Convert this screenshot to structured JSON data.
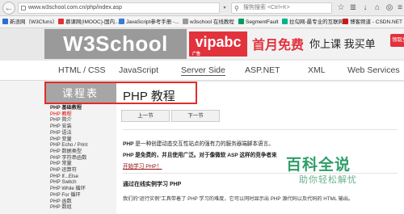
{
  "browser": {
    "url": "www.w3school.com.cn/php/index.asp",
    "search_placeholder": "搜狗搜索 <Ctrl+K>",
    "back_icon": "back-arrow-icon",
    "bookmarks": [
      {
        "label": "新浪网（W3Cfuns）",
        "color": "#2b6fd6"
      },
      {
        "label": "慕课网(IMOOC)-国内...",
        "color": "#d33"
      },
      {
        "label": "JavaScript参考手册 -...",
        "color": "#3a7bd5"
      },
      {
        "label": "w3school 在线教程",
        "color": "#9a9a9a"
      },
      {
        "label": "SegmentFault",
        "color": "#009a61"
      },
      {
        "label": "拉勾网-最专业的互联网...",
        "color": "#00b38a"
      },
      {
        "label": "博客频道 - CSDN.NET",
        "color": "#c91b1b"
      }
    ]
  },
  "header": {
    "logo": "W3School",
    "ad": {
      "brand": "vipabc",
      "brand_sub": "广告",
      "headline": "首月免费",
      "tagline": "你上课 我买单",
      "cta": "领取免费"
    }
  },
  "nav": {
    "items": [
      {
        "label": "HTML / CSS",
        "active": false
      },
      {
        "label": "JavaScript",
        "active": false
      },
      {
        "label": "Server Side",
        "active": true
      },
      {
        "label": "ASP.NET",
        "active": false
      },
      {
        "label": "XML",
        "active": false
      },
      {
        "label": "Web Services",
        "active": false
      }
    ]
  },
  "sidebar": {
    "title": "课程表",
    "items": [
      {
        "label": "PHP 基础教程",
        "type": "head"
      },
      {
        "label": "PHP 教程",
        "type": "current"
      },
      {
        "label": "PHP 简介",
        "type": "item"
      },
      {
        "label": "PHP 安装",
        "type": "item"
      },
      {
        "label": "PHP 语法",
        "type": "item"
      },
      {
        "label": "PHP 变量",
        "type": "item"
      },
      {
        "label": "PHP Echo / Print",
        "type": "item"
      },
      {
        "label": "PHP 数据类型",
        "type": "item"
      },
      {
        "label": "PHP 字符串函数",
        "type": "item"
      },
      {
        "label": "PHP 常量",
        "type": "item"
      },
      {
        "label": "PHP 运算符",
        "type": "item"
      },
      {
        "label": "PHP If...Else",
        "type": "item"
      },
      {
        "label": "PHP Switch",
        "type": "item"
      },
      {
        "label": "PHP While 循环",
        "type": "item"
      },
      {
        "label": "PHP For 循环",
        "type": "item"
      },
      {
        "label": "PHP 函数",
        "type": "item"
      },
      {
        "label": "PHP 数组",
        "type": "item"
      }
    ]
  },
  "content": {
    "title": "PHP 教程",
    "prev": "上一节",
    "next": "下一节",
    "intro1_bold": "PHP",
    "intro1_rest": " 是一种创建动态交互性站点的强有力的服务器端脚本语言。",
    "intro2_bold": "PHP 是免费的，并且使用广泛。对于像微软 ASP 这样的竞争者来",
    "link": "开始学习 PHP！",
    "subhead": "通过在线实例学习 PHP",
    "bottom": "我们的“运行实例”工具带着了 PHP 学习的难度，它可以同时显示出 PHP 源代码以及代码的 HTML 输出。"
  },
  "watermark": {
    "title": "百科全说",
    "sub": "助你轻松解忧"
  }
}
